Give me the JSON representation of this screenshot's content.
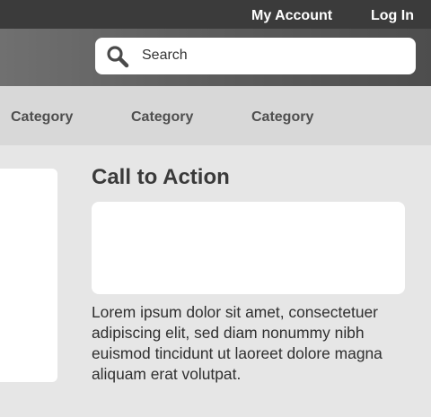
{
  "topnav": {
    "account_label": "My Account",
    "login_label": "Log In"
  },
  "search": {
    "placeholder": "Search",
    "icon": "search-icon"
  },
  "categories": [
    {
      "label": "Category"
    },
    {
      "label": "Category"
    },
    {
      "label": "Category"
    }
  ],
  "main": {
    "cta_heading": "Call to Action",
    "body_text": "Lorem ipsum dolor sit amet, consectetuer adipiscing elit, sed diam nonummy nibh euismod tincidunt ut laoreet dolore magna aliquam erat volutpat."
  },
  "colors": {
    "topbar": "#3b3b3b",
    "searchbar": "#5c5c5c",
    "category_bar": "#d8d8d8",
    "page_background": "#e6e6e6",
    "panel": "#ffffff"
  }
}
